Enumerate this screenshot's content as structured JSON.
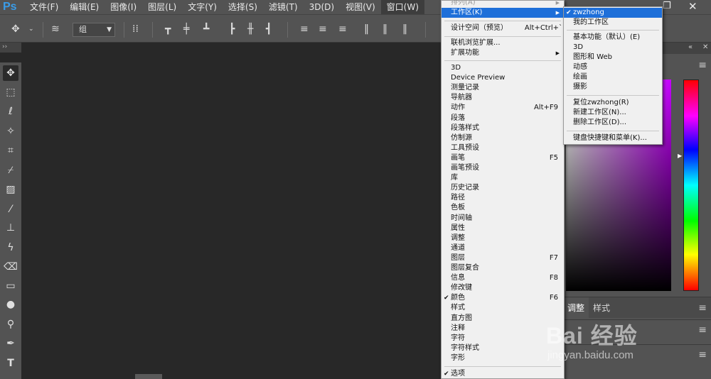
{
  "menubar": {
    "logo": "Ps",
    "items": [
      "文件(F)",
      "编辑(E)",
      "图像(I)",
      "图层(L)",
      "文字(Y)",
      "选择(S)",
      "滤镜(T)",
      "3D(D)",
      "视图(V)",
      "窗口(W)"
    ]
  },
  "options": {
    "group_select": "组"
  },
  "window_menu": {
    "arrange": "排列(A)",
    "workspace": "工作区(K)",
    "design_space": "设计空间（预览）",
    "design_space_shortcut": "Alt+Ctrl+`",
    "browse_ext": "联机浏览扩展...",
    "extensions": "扩展功能",
    "items": [
      {
        "label": "3D",
        "shortcut": "",
        "checked": false
      },
      {
        "label": "Device Preview",
        "shortcut": "",
        "checked": false
      },
      {
        "label": "测量记录",
        "shortcut": "",
        "checked": false
      },
      {
        "label": "导航器",
        "shortcut": "",
        "checked": false
      },
      {
        "label": "动作",
        "shortcut": "Alt+F9",
        "checked": false
      },
      {
        "label": "段落",
        "shortcut": "",
        "checked": false
      },
      {
        "label": "段落样式",
        "shortcut": "",
        "checked": false
      },
      {
        "label": "仿制源",
        "shortcut": "",
        "checked": false
      },
      {
        "label": "工具预设",
        "shortcut": "",
        "checked": false
      },
      {
        "label": "画笔",
        "shortcut": "F5",
        "checked": false
      },
      {
        "label": "画笔预设",
        "shortcut": "",
        "checked": false
      },
      {
        "label": "库",
        "shortcut": "",
        "checked": false
      },
      {
        "label": "历史记录",
        "shortcut": "",
        "checked": false
      },
      {
        "label": "路径",
        "shortcut": "",
        "checked": false
      },
      {
        "label": "色板",
        "shortcut": "",
        "checked": false
      },
      {
        "label": "时间轴",
        "shortcut": "",
        "checked": false
      },
      {
        "label": "属性",
        "shortcut": "",
        "checked": false
      },
      {
        "label": "调整",
        "shortcut": "",
        "checked": false
      },
      {
        "label": "通道",
        "shortcut": "",
        "checked": false
      },
      {
        "label": "图层",
        "shortcut": "F7",
        "checked": false
      },
      {
        "label": "图层复合",
        "shortcut": "",
        "checked": false
      },
      {
        "label": "信息",
        "shortcut": "F8",
        "checked": false
      },
      {
        "label": "修改键",
        "shortcut": "",
        "checked": false
      },
      {
        "label": "颜色",
        "shortcut": "F6",
        "checked": true
      },
      {
        "label": "样式",
        "shortcut": "",
        "checked": false
      },
      {
        "label": "直方图",
        "shortcut": "",
        "checked": false
      },
      {
        "label": "注释",
        "shortcut": "",
        "checked": false
      },
      {
        "label": "字符",
        "shortcut": "",
        "checked": false
      },
      {
        "label": "字符样式",
        "shortcut": "",
        "checked": false
      },
      {
        "label": "字形",
        "shortcut": "",
        "checked": false
      }
    ],
    "options_item": "选项"
  },
  "workspace_sub": {
    "current": "zwzhong",
    "my_workspace": "我的工作区",
    "presets": [
      "基本功能（默认）(E)",
      "3D",
      "图形和 Web",
      "动感",
      "绘画",
      "摄影"
    ],
    "reset": "复位zwzhong(R)",
    "new": "新建工作区(N)...",
    "delete": "删除工作区(D)...",
    "shortcuts": "键盘快捷键和菜单(K)..."
  },
  "panels": {
    "adjust_tab": "调整",
    "style_tab": "样式"
  },
  "watermark": {
    "brand": "Bai 经验",
    "url": "jingyan.baidu.com"
  },
  "colors": {
    "chrome": "#535353",
    "workspace": "#282828",
    "highlight": "#1e6fd9",
    "logo": "#3a9ce8"
  },
  "icons": [
    "move-icon",
    "layers-align-icon",
    "marquee-icon",
    "lasso-icon",
    "magic-wand-icon",
    "crop-icon",
    "eyedropper-icon",
    "healing-icon",
    "brush-icon",
    "stamp-icon",
    "history-brush-icon",
    "eraser-icon",
    "gradient-icon",
    "blur-icon",
    "dodge-icon",
    "pen-icon",
    "type-icon"
  ]
}
